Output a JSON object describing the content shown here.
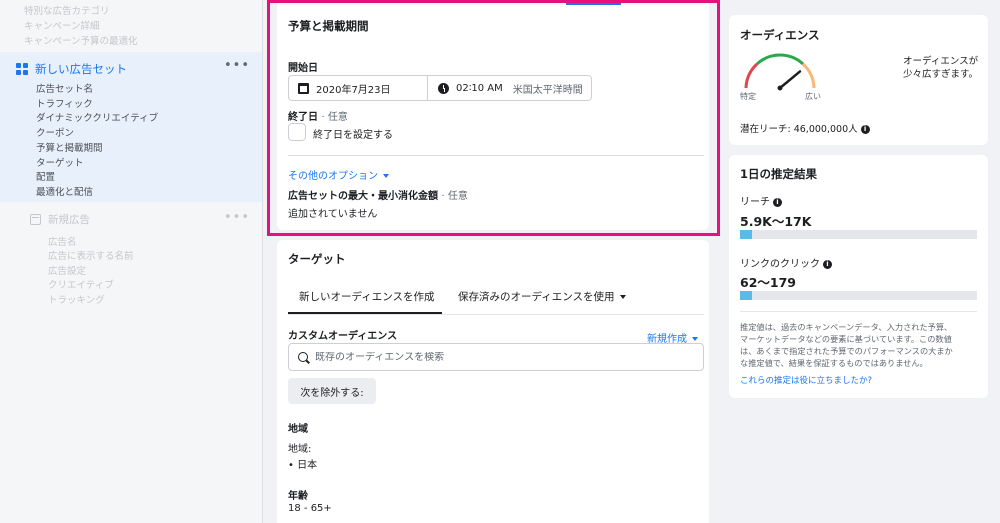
{
  "sidebar": {
    "top_items": [
      "特別な広告カテゴリ",
      "キャンペーン詳細",
      "キャンペーン予算の最適化"
    ],
    "adset_title": "新しい広告セット",
    "more": "•••",
    "adset_items": [
      "広告セット名",
      "トラフィック",
      "ダイナミッククリエイティブ",
      "クーポン",
      "予算と掲載期間",
      "ターゲット",
      "配置",
      "最適化と配信"
    ],
    "ad_title": "新規広告",
    "ad_items": [
      "広告名",
      "広告に表示する名前",
      "広告設定",
      "クリエイティブ",
      "トラッキング"
    ]
  },
  "budget": {
    "title": "予算と掲載期間",
    "start_label": "開始日",
    "start_date": "2020年7月23日",
    "start_time": "02∶10 AM",
    "timezone": "米国太平洋時間",
    "end_label": "終了日",
    "optional": "· 任意",
    "end_checkbox_label": "終了日を設定する",
    "other_options": "その他のオプション",
    "spend_label": "広告セットの最大・最小消化金額",
    "spend_value": "追加されていません"
  },
  "target": {
    "title": "ターゲット",
    "tab_new": "新しいオーディエンスを作成",
    "tab_saved": "保存済みのオーディエンスを使用",
    "custom_label": "カスタムオーディエンス",
    "create_new": "新規作成",
    "search_placeholder": "既存のオーディエンスを検索",
    "exclude_button": "次を除外する:",
    "region_title": "地域",
    "region_label": "地域:",
    "region_value": "• 日本",
    "age_title": "年齢",
    "age_value": "18 - 65+"
  },
  "audience": {
    "title": "オーディエンス",
    "description_line1": "オーディエンスが",
    "description_line2": "少々広すぎます。",
    "gauge_left": "特定",
    "gauge_right": "広い",
    "gauge_level": 0.78,
    "potential_reach": "潜在リーチ: 46,000,000人"
  },
  "estimate": {
    "title": "1日の推定結果",
    "reach_label": "リーチ",
    "reach_value": "5.9K〜17K",
    "reach_fill": 0.05,
    "clicks_label": "リンクのクリック",
    "clicks_value": "62〜179",
    "clicks_fill": 0.05,
    "note_lines": [
      "推定値は、過去のキャンペーンデータ、入力された予算、",
      "マーケットデータなどの要素に基づいています。この数値",
      "は、あくまで指定された予算でのパフォーマンスの大まか",
      "な推定値で、結果を保証するものではありません。"
    ],
    "feedback_link": "これらの推定は役に立ちましたか?"
  },
  "colors": {
    "accent": "#1877f2",
    "highlight": "#e5127d",
    "bar": "#58bce6",
    "gauge_red": "#e0464d",
    "gauge_green": "#2aa84a",
    "gauge_orange": "#f7b97a"
  }
}
